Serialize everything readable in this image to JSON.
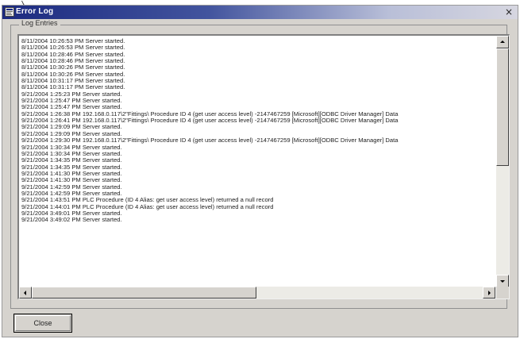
{
  "window": {
    "title": "Error Log",
    "close_glyph": "×",
    "title_icon": "app-icon"
  },
  "group": {
    "label": "Log Entries"
  },
  "log_entries": [
    "8/11/2004 10:26:53 PM  Server started.",
    "8/11/2004 10:26:53 PM  Server started.",
    "8/11/2004 10:28:46 PM  Server started.",
    "8/11/2004 10:28:46 PM  Server started.",
    "8/11/2004 10:30:26 PM  Server started.",
    "8/11/2004 10:30:26 PM  Server started.",
    "8/11/2004 10:31:17 PM  Server started.",
    "8/11/2004 10:31:17 PM  Server started.",
    "9/21/2004 1:25:23 PM  Server started.",
    "9/21/2004 1:25:47 PM  Server started.",
    "9/21/2004 1:25:47 PM  Server started.",
    "9/21/2004 1:26:38 PM  192.168.0.117\\2\"Fittings\\  Procedure ID 4 (get user access level)  -2147467259  [Microsoft][ODBC Driver Manager] Data",
    "9/21/2004 1:26:41 PM  192.168.0.117\\2\"Fittings\\  Procedure ID 4 (get user access level)  -2147467259  [Microsoft][ODBC Driver Manager] Data",
    "9/21/2004 1:29:09 PM  Server started.",
    "9/21/2004 1:29:09 PM  Server started.",
    "9/21/2004 1:29:30 PM  192.168.0.117\\2\"Fittings\\  Procedure ID 4 (get user access level)  -2147467259  [Microsoft][ODBC Driver Manager] Data",
    "9/21/2004 1:30:34 PM  Server started.",
    "9/21/2004 1:30:34 PM  Server started.",
    "9/21/2004 1:34:35 PM  Server started.",
    "9/21/2004 1:34:35 PM  Server started.",
    "9/21/2004 1:41:30 PM  Server started.",
    "9/21/2004 1:41:30 PM  Server started.",
    "9/21/2004 1:42:59 PM  Server started.",
    "9/21/2004 1:42:59 PM  Server started.",
    "9/21/2004 1:43:51 PM  PLC Procedure (ID 4 Alias: get user access level) returned a null record",
    "9/21/2004 1:44:01 PM  PLC Procedure (ID 4 Alias: get user access level) returned a null record",
    "9/21/2004 3:49:01 PM  Server started.",
    "9/21/2004 3:49:02 PM  Server started."
  ],
  "buttons": {
    "close_label": "Close"
  },
  "colors": {
    "title_bar_start": "#1c2a80",
    "title_bar_end": "#d6d6e0",
    "dialog_face": "#d6d3ce"
  }
}
